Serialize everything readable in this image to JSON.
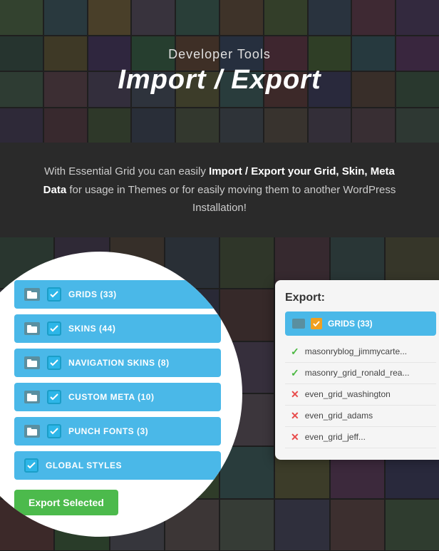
{
  "hero": {
    "subtitle": "Developer Tools",
    "title": "Import / Export"
  },
  "description": {
    "text_start": "With Essential Grid you can easily ",
    "text_bold": "Import / Export your Grid, Skin, Meta Data",
    "text_end": " for usage in Themes or for easily moving them to another WordPress Installation!"
  },
  "checklist": {
    "items": [
      {
        "label": "GRIDS (33)"
      },
      {
        "label": "SKINS (44)"
      },
      {
        "label": "NAVIGATION SKINS (8)"
      },
      {
        "label": "CUSTOM META (10)"
      },
      {
        "label": "PUNCH FONTS (3)"
      },
      {
        "label": "GLOBAL STYLES"
      }
    ],
    "export_button": "Export Selected"
  },
  "export_panel": {
    "label": "Export:",
    "header": "GRIDS (33)",
    "rows": [
      {
        "status": "check",
        "label": "masonryblog_jimmycarte..."
      },
      {
        "status": "check",
        "label": "masonry_grid_ronald_rea..."
      },
      {
        "status": "x",
        "label": "even_grid_washington"
      },
      {
        "status": "x",
        "label": "even_grid_adams"
      },
      {
        "status": "x",
        "label": "even_grid_jeff..."
      }
    ]
  },
  "mosaic_cells": 40
}
